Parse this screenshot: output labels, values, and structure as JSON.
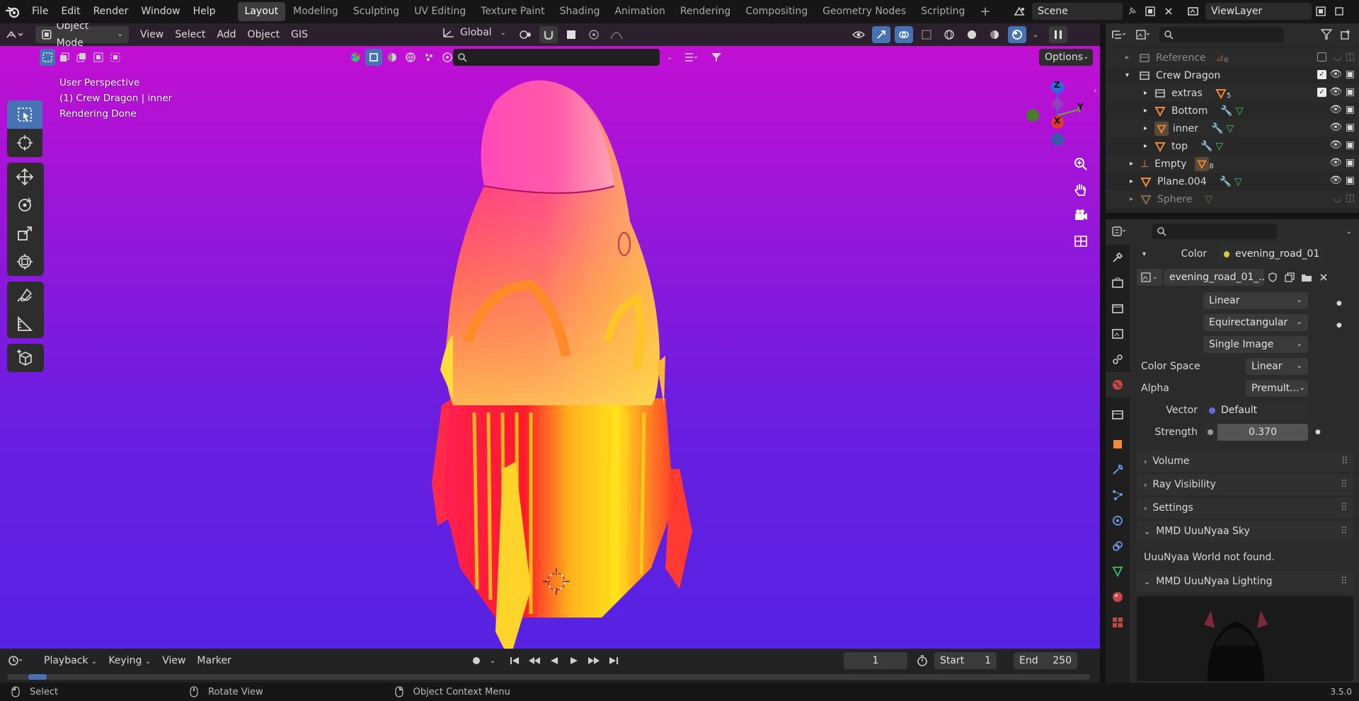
{
  "topbar": {
    "menus": [
      "File",
      "Edit",
      "Render",
      "Window",
      "Help"
    ],
    "workspaces": [
      "Layout",
      "Modeling",
      "Sculpting",
      "UV Editing",
      "Texture Paint",
      "Shading",
      "Animation",
      "Rendering",
      "Compositing",
      "Geometry Nodes",
      "Scripting"
    ],
    "active_workspace": "Layout",
    "scene": "Scene",
    "view_layer": "ViewLayer"
  },
  "viewport": {
    "header": {
      "mode": "Object Mode",
      "menus": [
        "View",
        "Select",
        "Add",
        "Object",
        "GIS"
      ],
      "orientation": "Global",
      "options": "Options"
    },
    "overlay_text": [
      "User Perspective",
      "(1) Crew Dragon | inner",
      "Rendering Done"
    ],
    "gizmo": {
      "z": "Z",
      "y": "Y",
      "x": "X"
    }
  },
  "outliner": {
    "rows": [
      {
        "name": "Reference",
        "indent": 1,
        "badge": "6",
        "dim": true
      },
      {
        "name": "Crew Dragon",
        "indent": 1,
        "dim": false
      },
      {
        "name": "extras",
        "indent": 2,
        "badge": "5",
        "dim": false
      },
      {
        "name": "Bottom",
        "indent": 2,
        "dim": false
      },
      {
        "name": "inner",
        "indent": 2,
        "dim": false
      },
      {
        "name": "top",
        "indent": 2,
        "dim": false
      },
      {
        "name": "Empty",
        "indent": 1,
        "badge": "8",
        "dim": false
      },
      {
        "name": "Plane.004",
        "indent": 1,
        "dim": false
      },
      {
        "name": "Sphere",
        "indent": 1,
        "dim": true
      }
    ]
  },
  "properties": {
    "color_label": "Color",
    "color_value": "evening_road_01...",
    "image_name": "evening_road_01_...",
    "interpolation": "Linear",
    "projection": "Equirectangular",
    "source": "Single Image",
    "color_space_label": "Color Space",
    "color_space": "Linear",
    "alpha_label": "Alpha",
    "alpha": "Premult...",
    "vector_label": "Vector",
    "vector": "Default",
    "strength_label": "Strength",
    "strength": "0.370",
    "panels": [
      "Volume",
      "Ray Visibility",
      "Settings"
    ],
    "sky_panel": "MMD UuuNyaa Sky",
    "sky_message": "UuuNyaa World not found.",
    "lighting_panel": "MMD UuuNyaa Lighting"
  },
  "timeline": {
    "menus": [
      "Playback",
      "Keying",
      "View",
      "Marker"
    ],
    "current_frame": "1",
    "start_label": "Start",
    "start": "1",
    "end_label": "End",
    "end": "250"
  },
  "statusbar": {
    "select": "Select",
    "rotate": "Rotate View",
    "context": "Object Context Menu",
    "version": "3.5.0"
  }
}
